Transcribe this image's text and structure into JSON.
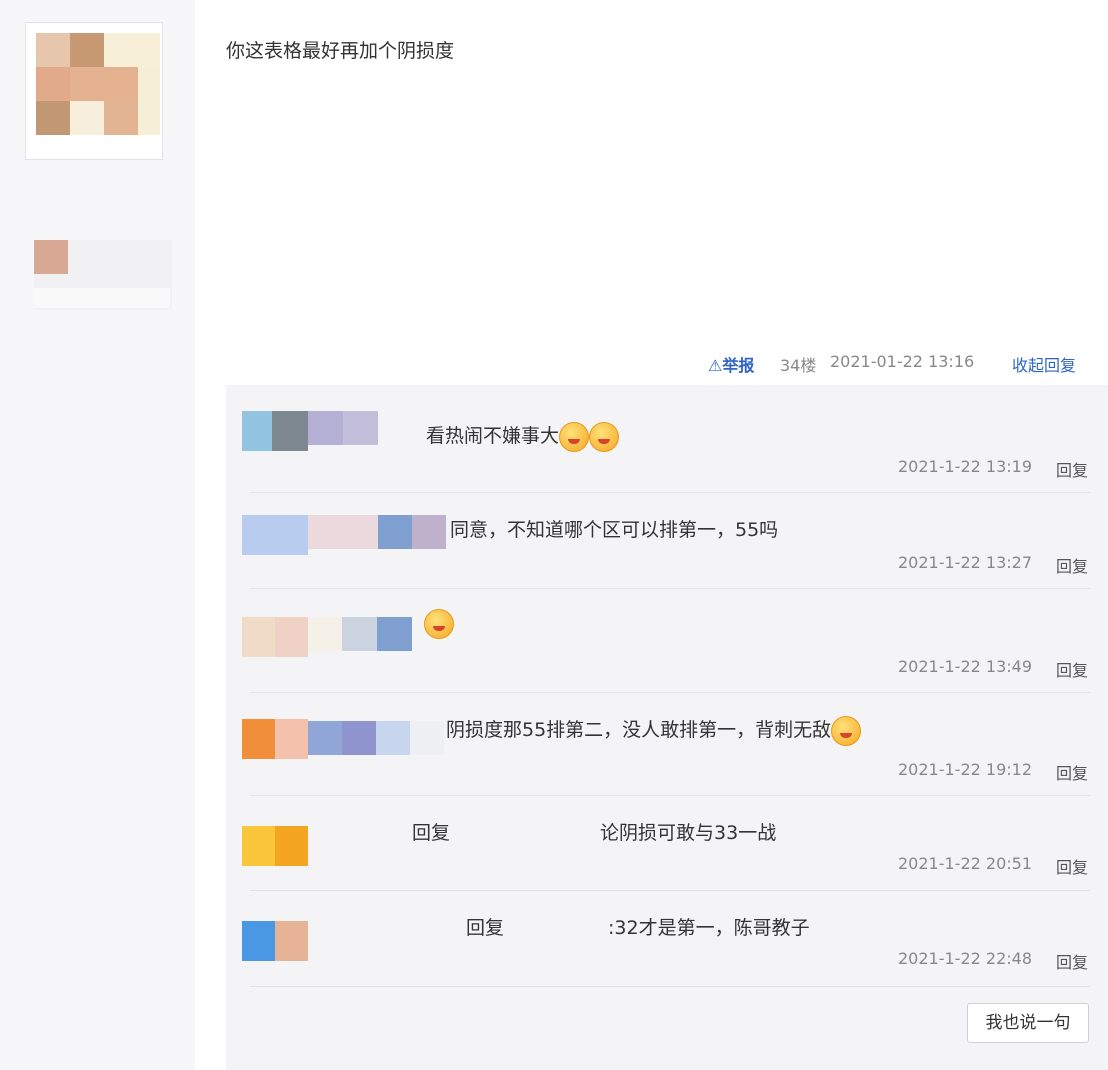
{
  "post": {
    "text": "你这表格最好再加个阴损度"
  },
  "meta": {
    "report_icon": "warning-triangle-icon",
    "report_label": "举报",
    "floor": "34楼",
    "timestamp": "2021-01-22 13:16",
    "collapse_label": "收起回复"
  },
  "replies": [
    {
      "text": "看热闹不嫌事大",
      "emoji": [
        "smile-emoji",
        "smile-emoji"
      ],
      "time": "2021-1-22 13:19",
      "reply_label": "回复"
    },
    {
      "text": "同意，不知道哪个区可以排第一，55吗",
      "time": "2021-1-22 13:27",
      "reply_label": "回复"
    },
    {
      "text": "",
      "emoji": [
        "laugh-emoji"
      ],
      "time": "2021-1-22 13:49",
      "reply_label": "回复"
    },
    {
      "text": "阴损度那55排第二，没人敢排第一，背刺无敌",
      "emoji": [
        "laugh-emoji"
      ],
      "time": "2021-1-22 19:12",
      "reply_label": "回复"
    },
    {
      "prefix": "回复",
      "text": "论阴损可敢与33一战",
      "time": "2021-1-22 20:51",
      "reply_label": "回复"
    },
    {
      "prefix": "回复",
      "text": ":32才是第一，陈哥教子",
      "time": "2021-1-22 22:48",
      "reply_label": "回复"
    }
  ],
  "say_button": "我也说一句"
}
